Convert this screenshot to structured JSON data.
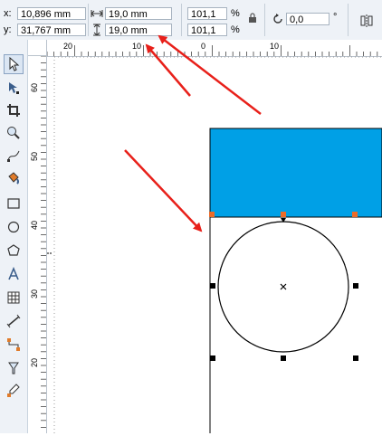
{
  "property_bar": {
    "x_label": "x:",
    "y_label": "y:",
    "x_value": "10,896 mm",
    "y_value": "31,767 mm",
    "width_value": "19,0 mm",
    "height_value": "19,0 mm",
    "scale_x": "101,1",
    "scale_y": "101,1",
    "percent_symbol": "%",
    "angle_value": "0,0",
    "degree_symbol": "°"
  },
  "toolbox": {
    "tools": [
      "pick-tool",
      "shape-tool",
      "crop-tool",
      "zoom-tool",
      "freehand-tool",
      "smart-fill-tool",
      "rectangle-tool",
      "ellipse-tool",
      "polygon-tool",
      "text-tool",
      "table-tool",
      "dimension-tool",
      "connector-tool",
      "blend-tool",
      "eyedropper-tool"
    ],
    "active": "pick-tool"
  },
  "rulers": {
    "horizontal_labels": [
      "20",
      "10",
      "0",
      "10"
    ],
    "vertical_labels": [
      "60",
      "50",
      "40",
      "30",
      "20"
    ]
  },
  "canvas": {
    "rectangle_fill": "#00a0e6",
    "circle_stroke": "#000000",
    "handle_color_selected": "#ec6b28",
    "handle_color": "#000000",
    "arrow_color": "#e8201a",
    "guide_line": "#000000"
  }
}
